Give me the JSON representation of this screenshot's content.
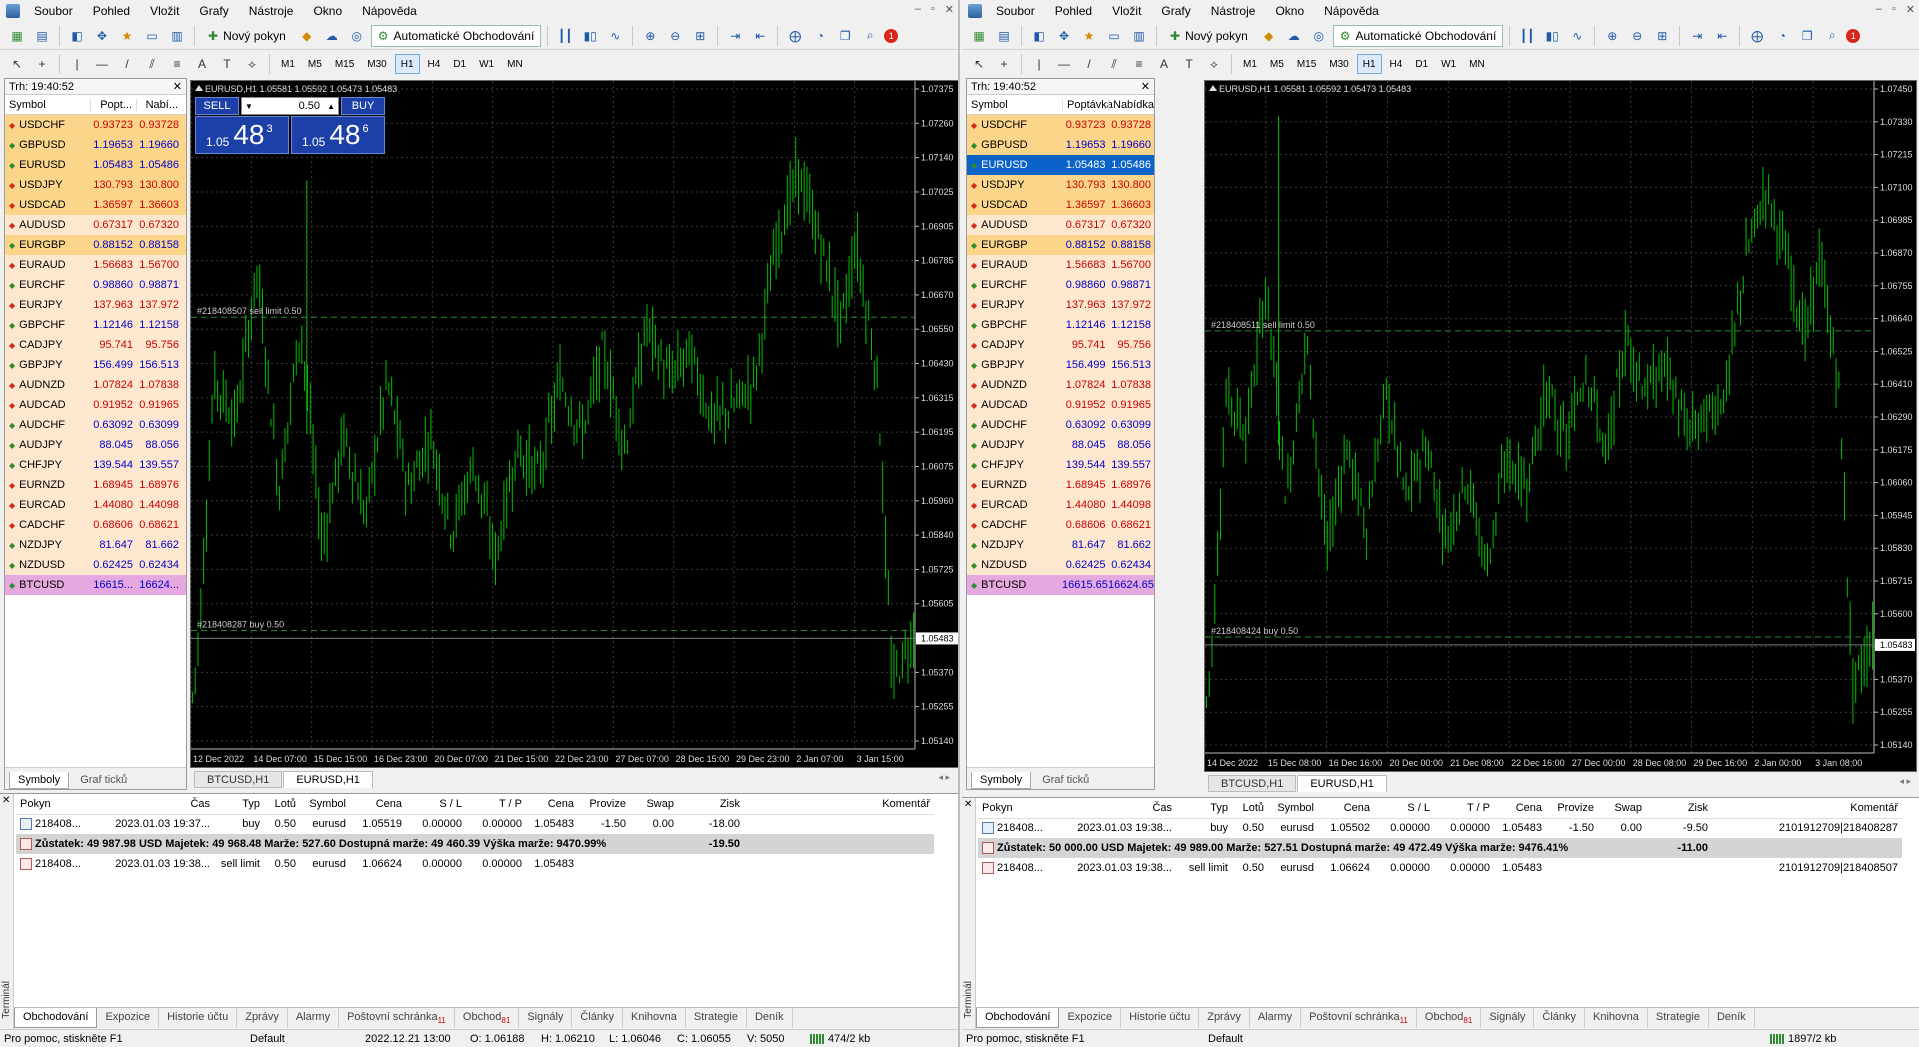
{
  "menu": [
    "Soubor",
    "Pohled",
    "Vložit",
    "Grafy",
    "Nástroje",
    "Okno",
    "Nápověda"
  ],
  "toolbar": {
    "new_order": "Nový pokyn",
    "auto_trading": "Automatické Obchodování",
    "notif_count": "1"
  },
  "timeframes": [
    "M1",
    "M5",
    "M15",
    "M30",
    "H1",
    "H4",
    "D1",
    "W1",
    "MN"
  ],
  "left": {
    "market_watch": {
      "title": "Trh: 19:40:52",
      "col_symbol": "Symbol",
      "col_bid": "Popt...",
      "col_ask": "Nabí...",
      "tab_symbols": "Symboly",
      "tab_tick": "Graf ticků"
    },
    "chart": {
      "header": "EURUSD,H1  1.05581 1.05592 1.05473 1.05483",
      "sell_limit_label": "#218408507 sell limit 0.50",
      "buy_label": "#218408287 buy 0.50",
      "one_click": {
        "sell": "SELL",
        "buy": "BUY",
        "lots": "0.50",
        "sell_small": "1.05",
        "sell_big": "48",
        "sell_sup": "3",
        "buy_small": "1.05",
        "buy_big": "48",
        "buy_sup": "6"
      },
      "price_labels": [
        "1.07375",
        "1.07260",
        "1.07140",
        "1.07025",
        "1.06905",
        "1.06785",
        "1.06670",
        "1.06550",
        "1.06430",
        "1.06315",
        "1.06195",
        "1.06075",
        "1.05960",
        "1.05840",
        "1.05725",
        "1.05605",
        "1.05483",
        "1.05370",
        "1.05255",
        "1.05140"
      ],
      "time_labels": [
        "12 Dec 2022",
        "14 Dec 07:00",
        "15 Dec 15:00",
        "16 Dec 23:00",
        "20 Dec 07:00",
        "21 Dec 15:00",
        "22 Dec 23:00",
        "27 Dec 07:00",
        "28 Dec 15:00",
        "29 Dec 23:00",
        "2 Jan 07:00",
        "3 Jan 15:00"
      ],
      "tabs": [
        "BTCUSD,H1",
        "EURUSD,H1"
      ]
    },
    "terminal": {
      "headers": [
        "Pokyn",
        "Čas",
        "Typ",
        "Lotů",
        "Symbol",
        "Cena",
        "S / L",
        "T / P",
        "Cena",
        "Provize",
        "Swap",
        "Zisk",
        "Komentář"
      ],
      "rows": [
        [
          "218408...",
          "2023.01.03 19:37...",
          "buy",
          "0.50",
          "eurusd",
          "1.05519",
          "0.00000",
          "0.00000",
          "1.05483",
          "-1.50",
          "0.00",
          "-18.00",
          ""
        ],
        [
          "218408...",
          "2023.01.03 19:38...",
          "sell limit",
          "0.50",
          "eurusd",
          "1.06624",
          "0.00000",
          "0.00000",
          "1.05483",
          "",
          "",
          "",
          ""
        ]
      ],
      "balance": "Zůstatek: 49 987.98 USD  Majetek: 49 968.48  Marže: 527.60  Dostupná marže: 49 460.39  Výška marže: 9470.99%",
      "balance_profit": "-19.50",
      "side_label": "Terminál"
    },
    "status": {
      "help": "Pro pomoc, stiskněte F1",
      "profile": "Default",
      "datetime": "2022.12.21 13:00",
      "open": "O: 1.06188",
      "high": "H: 1.06210",
      "low": "L: 1.06046",
      "close": "C: 1.06055",
      "volume": "V: 5050",
      "traffic": "474/2 kb"
    }
  },
  "right": {
    "market_watch": {
      "title": "Trh: 19:40:52",
      "col_symbol": "Symbol",
      "col_bid": "Poptávka",
      "col_ask": "Nabídka",
      "tab_symbols": "Symboly",
      "tab_tick": "Graf ticků"
    },
    "chart": {
      "header": "EURUSD,H1  1.05581 1.05592 1.05473 1.05483",
      "sell_limit_label": "#218408511 sell limit 0.50",
      "buy_label": "#218408424 buy 0.50",
      "price_labels": [
        "1.07450",
        "1.07330",
        "1.07215",
        "1.07100",
        "1.06985",
        "1.06870",
        "1.06755",
        "1.06640",
        "1.06525",
        "1.06410",
        "1.06290",
        "1.06175",
        "1.06060",
        "1.05945",
        "1.05830",
        "1.05715",
        "1.05600",
        "1.05483",
        "1.05370",
        "1.05255",
        "1.05140"
      ],
      "time_labels": [
        "14 Dec 2022",
        "15 Dec 08:00",
        "16 Dec 16:00",
        "20 Dec 00:00",
        "21 Dec 08:00",
        "22 Dec 16:00",
        "27 Dec 00:00",
        "28 Dec 08:00",
        "29 Dec 16:00",
        "2 Jan 00:00",
        "3 Jan 08:00"
      ],
      "tabs": [
        "BTCUSD,H1",
        "EURUSD,H1"
      ]
    },
    "terminal": {
      "headers": [
        "Pokyn",
        "Čas",
        "Typ",
        "Lotů",
        "Symbol",
        "Cena",
        "S / L",
        "T / P",
        "Cena",
        "Provize",
        "Swap",
        "Zisk",
        "Komentář"
      ],
      "rows": [
        [
          "218408...",
          "2023.01.03 19:38...",
          "buy",
          "0.50",
          "eurusd",
          "1.05502",
          "0.00000",
          "0.00000",
          "1.05483",
          "-1.50",
          "0.00",
          "-9.50",
          "2101912709|218408287"
        ],
        [
          "218408...",
          "2023.01.03 19:38...",
          "sell limit",
          "0.50",
          "eurusd",
          "1.06624",
          "0.00000",
          "0.00000",
          "1.05483",
          "",
          "",
          "",
          "2101912709|218408507"
        ]
      ],
      "balance": "Zůstatek: 50 000.00 USD  Majetek: 49 989.00  Marže: 527.51  Dostupná marže: 49 472.49  Výška marže: 9476.41%",
      "balance_profit": "-11.00",
      "side_label": "Terminál"
    },
    "status": {
      "help": "Pro pomoc, stiskněte F1",
      "profile": "Default",
      "traffic": "1897/2 kb"
    }
  },
  "symbols": [
    {
      "s": "USDCHF",
      "b": "0.93723",
      "a": "0.93728",
      "bg": "#fbd68a",
      "c": "red"
    },
    {
      "s": "GBPUSD",
      "b": "1.19653",
      "a": "1.19660",
      "bg": "#fbd68a",
      "c": "blue"
    },
    {
      "s": "EURUSD",
      "b": "1.05483",
      "a": "1.05486",
      "bg": "#fbd68a",
      "c": "blue"
    },
    {
      "s": "USDJPY",
      "b": "130.793",
      "a": "130.800",
      "bg": "#fbd68a",
      "c": "red"
    },
    {
      "s": "USDCAD",
      "b": "1.36597",
      "a": "1.36603",
      "bg": "#fbd68a",
      "c": "red"
    },
    {
      "s": "AUDUSD",
      "b": "0.67317",
      "a": "0.67320",
      "bg": "#fde8cf",
      "c": "red"
    },
    {
      "s": "EURGBP",
      "b": "0.88152",
      "a": "0.88158",
      "bg": "#fbd68a",
      "c": "blue"
    },
    {
      "s": "EURAUD",
      "b": "1.56683",
      "a": "1.56700",
      "bg": "#fde8cf",
      "c": "red"
    },
    {
      "s": "EURCHF",
      "b": "0.98860",
      "a": "0.98871",
      "bg": "#fde8cf",
      "c": "blue"
    },
    {
      "s": "EURJPY",
      "b": "137.963",
      "a": "137.972",
      "bg": "#fde8cf",
      "c": "red"
    },
    {
      "s": "GBPCHF",
      "b": "1.12146",
      "a": "1.12158",
      "bg": "#fde8cf",
      "c": "blue"
    },
    {
      "s": "CADJPY",
      "b": "95.741",
      "a": "95.756",
      "bg": "#fde8cf",
      "c": "red"
    },
    {
      "s": "GBPJPY",
      "b": "156.499",
      "a": "156.513",
      "bg": "#fde8cf",
      "c": "blue"
    },
    {
      "s": "AUDNZD",
      "b": "1.07824",
      "a": "1.07838",
      "bg": "#fde8cf",
      "c": "red"
    },
    {
      "s": "AUDCAD",
      "b": "0.91952",
      "a": "0.91965",
      "bg": "#fde8cf",
      "c": "red"
    },
    {
      "s": "AUDCHF",
      "b": "0.63092",
      "a": "0.63099",
      "bg": "#fde8cf",
      "c": "blue"
    },
    {
      "s": "AUDJPY",
      "b": "88.045",
      "a": "88.056",
      "bg": "#fde8cf",
      "c": "blue"
    },
    {
      "s": "CHFJPY",
      "b": "139.544",
      "a": "139.557",
      "bg": "#fde8cf",
      "c": "blue"
    },
    {
      "s": "EURNZD",
      "b": "1.68945",
      "a": "1.68976",
      "bg": "#fde8cf",
      "c": "red"
    },
    {
      "s": "EURCAD",
      "b": "1.44080",
      "a": "1.44098",
      "bg": "#fde8cf",
      "c": "red"
    },
    {
      "s": "CADCHF",
      "b": "0.68606",
      "a": "0.68621",
      "bg": "#fde8cf",
      "c": "red"
    },
    {
      "s": "NZDJPY",
      "b": "81.647",
      "a": "81.662",
      "bg": "#fde8cf",
      "c": "blue"
    },
    {
      "s": "NZDUSD",
      "b": "0.62425",
      "a": "0.62434",
      "bg": "#fde8cf",
      "c": "blue"
    },
    {
      "s": "BTCUSD",
      "bL": "16615...",
      "aL": "16624...",
      "b": "16615.65",
      "a": "16624.65",
      "bg": "#e5a9df",
      "c": "blue"
    }
  ],
  "term_tabs": [
    {
      "t": "Obchodování"
    },
    {
      "t": "Expozice"
    },
    {
      "t": "Historie účtu"
    },
    {
      "t": "Zprávy"
    },
    {
      "t": "Alarmy"
    },
    {
      "t": "Poštovní schránka",
      "n": "11"
    },
    {
      "t": "Obchod",
      "n": "81"
    },
    {
      "t": "Signály"
    },
    {
      "t": "Články"
    },
    {
      "t": "Knihovna"
    },
    {
      "t": "Strategie"
    },
    {
      "t": "Deník"
    }
  ],
  "colors": {
    "candle": "#00c000",
    "grid": "#3a3a3a",
    "bg": "#000000"
  }
}
